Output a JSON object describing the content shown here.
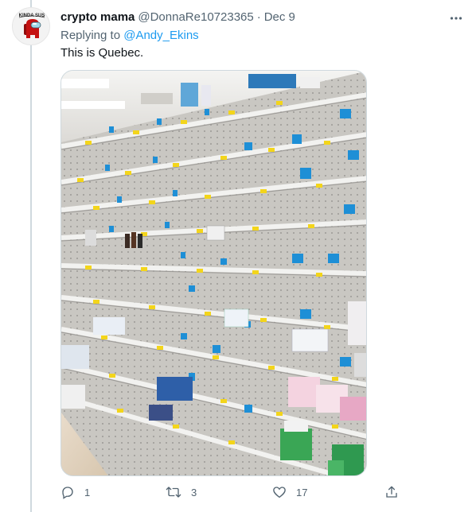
{
  "tweet": {
    "display_name": "crypto mama",
    "handle": "@DonnaRe10723365",
    "separator": "·",
    "date": "Dec 9",
    "replying_prefix": "Replying to ",
    "replying_to": "@Andy_Ekins",
    "text": "This is Quebec.",
    "avatar_caption": "KINDA SUS",
    "media_icon": "store-shelf-photo",
    "more_icon": "more-dots-icon"
  },
  "actions": {
    "reply_count": "1",
    "retweet_count": "3",
    "like_count": "17",
    "reply_icon": "reply-icon",
    "retweet_icon": "retweet-icon",
    "like_icon": "heart-icon",
    "share_icon": "share-icon"
  },
  "colors": {
    "text": "#0f1419",
    "muted": "#536471",
    "link": "#1d9bf0",
    "border": "#cfd9de",
    "avatar_character": "#c51111"
  }
}
